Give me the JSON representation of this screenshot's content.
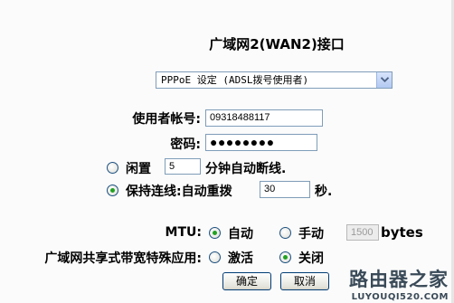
{
  "page": {
    "title": "广域网2(WAN2)接口"
  },
  "connection_type": {
    "selected": "PPPoE 设定 (ADSL拨号使用者)"
  },
  "account": {
    "username_label": "使用者帐号:",
    "username_value": "09318488117",
    "password_label": "密码:",
    "password_value": "●●●●●●●●"
  },
  "idle": {
    "label": "闲置",
    "minutes_value": "5",
    "suffix": "分钟自动断线."
  },
  "keepalive": {
    "label": "保持连线:自动重拨",
    "seconds_value": "30",
    "suffix": "秒."
  },
  "mtu": {
    "label": "MTU:",
    "auto_label": "自动",
    "manual_label": "手动",
    "value_placeholder": "1500",
    "unit": "bytes"
  },
  "bandwidth_sharing": {
    "label": "广域网共享式带宽特殊应用:",
    "activate_label": "激活",
    "off_label": "关闭"
  },
  "buttons": {
    "ok": "确定",
    "cancel": "取消"
  },
  "watermark": {
    "name": "路由器之家",
    "url": "LUYOUQI520.COM"
  }
}
